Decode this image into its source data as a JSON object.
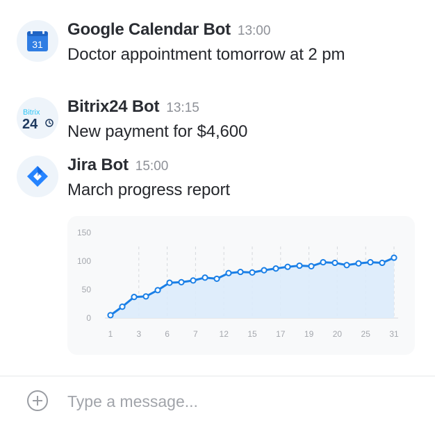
{
  "messages": [
    {
      "sender": "Google Calendar Bot",
      "time": "13:00",
      "text": "Doctor appointment tomorrow at 2 pm",
      "avatar_text": "31",
      "avatar_icon": "google-calendar-icon"
    },
    {
      "sender": "Bitrix24 Bot",
      "time": "13:15",
      "text": "New payment for $4,600",
      "avatar_brand": "Bitrix",
      "avatar_number": "24",
      "avatar_icon": "bitrix24-logo"
    },
    {
      "sender": "Jira Bot",
      "time": "15:00",
      "text": "March progress report",
      "avatar_icon": "jira-logo"
    }
  ],
  "colors": {
    "accent": "#1a7fe6",
    "area_fill": "#dcebfb",
    "calendar_blue": "#2f7de3",
    "bitrix_cyan": "#2fc6f6",
    "bitrix_navy": "#1e3a5f",
    "jira_blue": "#2684ff"
  },
  "chart_data": {
    "type": "area",
    "y_ticks": [
      "0",
      "50",
      "100",
      "150"
    ],
    "x_ticks": [
      "1",
      "3",
      "6",
      "7",
      "12",
      "15",
      "17",
      "19",
      "20",
      "25",
      "31"
    ],
    "ylim": [
      0,
      150
    ],
    "grid": "vertical dashed lines at x ticks",
    "points": [
      {
        "x": 1,
        "y": 5
      },
      {
        "x": 2,
        "y": 20
      },
      {
        "x": 3,
        "y": 37
      },
      {
        "x": 4,
        "y": 38
      },
      {
        "x": 5,
        "y": 49
      },
      {
        "x": 6,
        "y": 62
      },
      {
        "x": 7,
        "y": 63
      },
      {
        "x": 8,
        "y": 66
      },
      {
        "x": 9,
        "y": 71
      },
      {
        "x": 10,
        "y": 69
      },
      {
        "x": 11,
        "y": 79
      },
      {
        "x": 12,
        "y": 81
      },
      {
        "x": 13,
        "y": 80
      },
      {
        "x": 14,
        "y": 84
      },
      {
        "x": 15,
        "y": 87
      },
      {
        "x": 16,
        "y": 90
      },
      {
        "x": 17,
        "y": 92
      },
      {
        "x": 18,
        "y": 91
      },
      {
        "x": 19,
        "y": 98
      },
      {
        "x": 20,
        "y": 97
      },
      {
        "x": 21,
        "y": 93
      },
      {
        "x": 22,
        "y": 96
      },
      {
        "x": 23,
        "y": 98
      },
      {
        "x": 24,
        "y": 97
      },
      {
        "x": 25,
        "y": 106
      }
    ]
  },
  "composer": {
    "placeholder": "Type a message...",
    "add_icon": "plus-circle-icon"
  }
}
